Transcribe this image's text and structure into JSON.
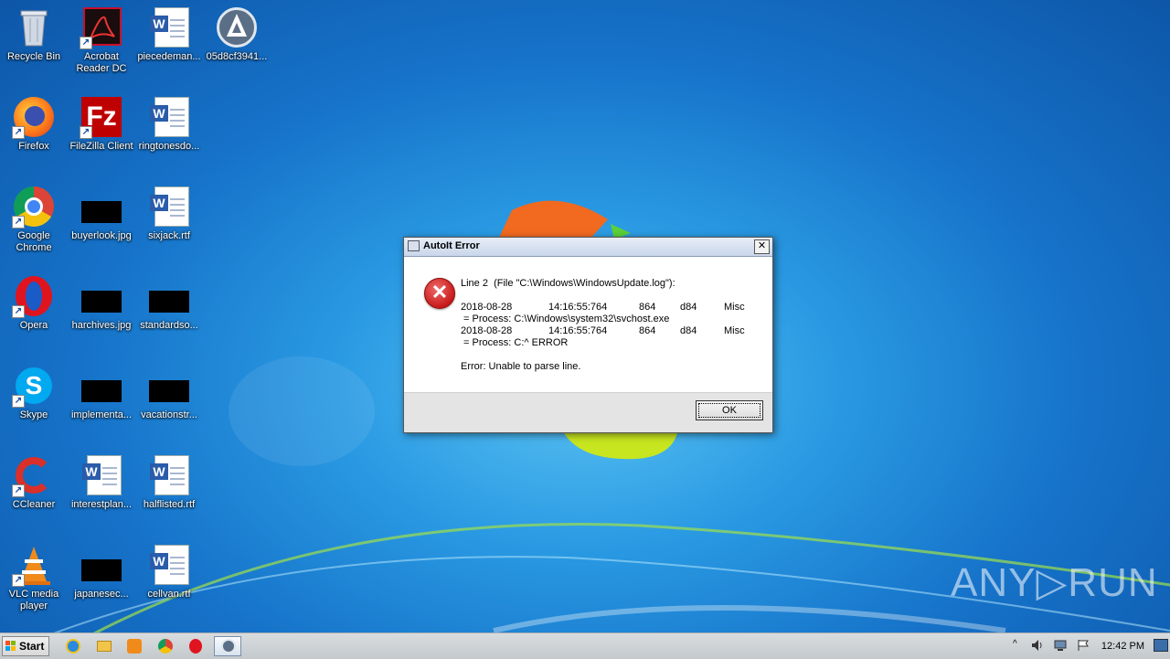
{
  "desktop": {
    "icons": [
      {
        "label": "Recycle Bin"
      },
      {
        "label": "Acrobat Reader DC"
      },
      {
        "label": "piecedeman..."
      },
      {
        "label": "05d8cf3941..."
      },
      {
        "label": "Firefox"
      },
      {
        "label": "FileZilla Client"
      },
      {
        "label": "ringtonesdo..."
      },
      {
        "label": "Google Chrome"
      },
      {
        "label": "buyerlook.jpg"
      },
      {
        "label": "sixjack.rtf"
      },
      {
        "label": "Opera"
      },
      {
        "label": "harchives.jpg"
      },
      {
        "label": "standardso..."
      },
      {
        "label": "Skype"
      },
      {
        "label": "implementa..."
      },
      {
        "label": "vacationstr..."
      },
      {
        "label": "CCleaner"
      },
      {
        "label": "interestplan..."
      },
      {
        "label": "halflisted.rtf"
      },
      {
        "label": "VLC media player"
      },
      {
        "label": "japanesec..."
      },
      {
        "label": "cellvan.rtf"
      }
    ],
    "watermark": "ANY▷RUN"
  },
  "dialog": {
    "title": "AutoIt Error",
    "close": "✕",
    "line1": "Line 2  (File \"C:\\Windows\\WindowsUpdate.log\"):",
    "rows": [
      {
        "date": "2018-08-28",
        "time": "14:16:55:764",
        "pid": "864",
        "tid": "d84",
        "cat": "Misc"
      },
      {
        "cont": " = Process: C:\\Windows\\system32\\svchost.exe"
      },
      {
        "date": "2018-08-28",
        "time": "14:16:55:764",
        "pid": "864",
        "tid": "d84",
        "cat": "Misc"
      },
      {
        "cont": " = Process: C:^ ERROR"
      }
    ],
    "error": "Error: Unable to parse line.",
    "ok": "OK"
  },
  "taskbar": {
    "start": "Start",
    "clock": "12:42 PM"
  }
}
